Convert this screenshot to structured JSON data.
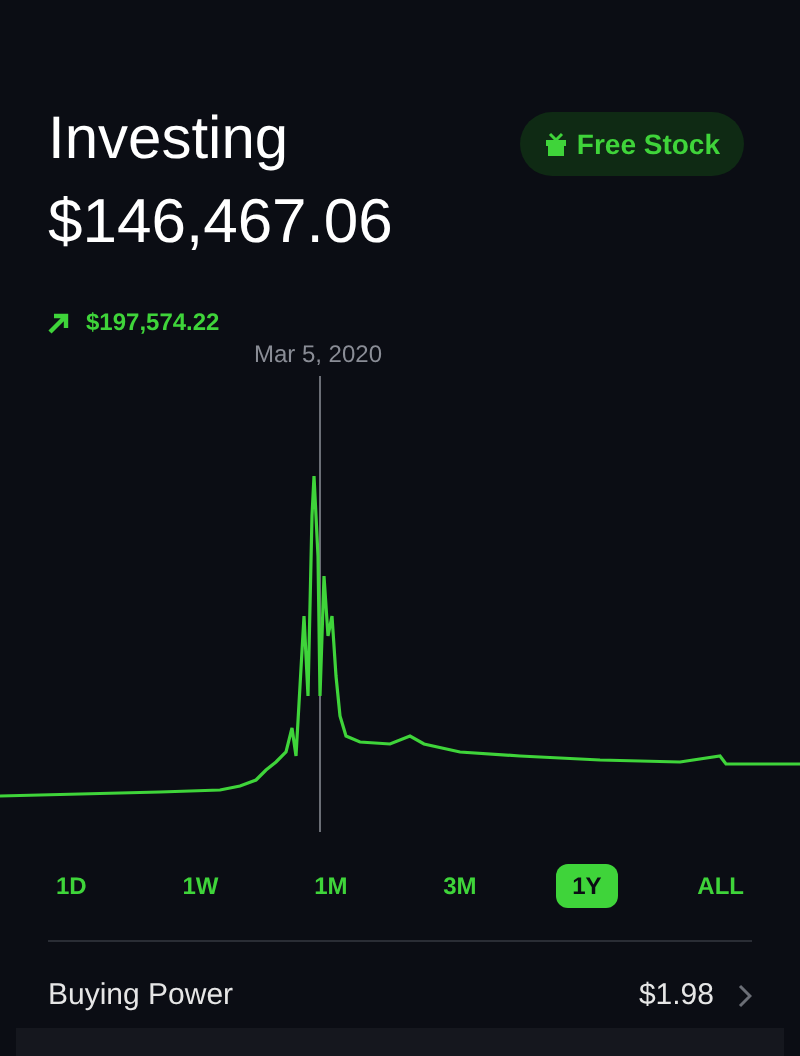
{
  "header": {
    "title": "Investing",
    "balance": "$146,467.06",
    "change": "$197,574.22"
  },
  "free_stock_button": {
    "label": "Free Stock"
  },
  "chart": {
    "kind": "picture",
    "cursor_label": "Mar 5, 2020"
  },
  "ranges": [
    {
      "label": "1D",
      "selected": false
    },
    {
      "label": "1W",
      "selected": false
    },
    {
      "label": "1M",
      "selected": false
    },
    {
      "label": "3M",
      "selected": false
    },
    {
      "label": "1Y",
      "selected": true
    },
    {
      "label": "ALL",
      "selected": false
    }
  ],
  "buying_power": {
    "label": "Buying Power",
    "value": "$1.98"
  }
}
